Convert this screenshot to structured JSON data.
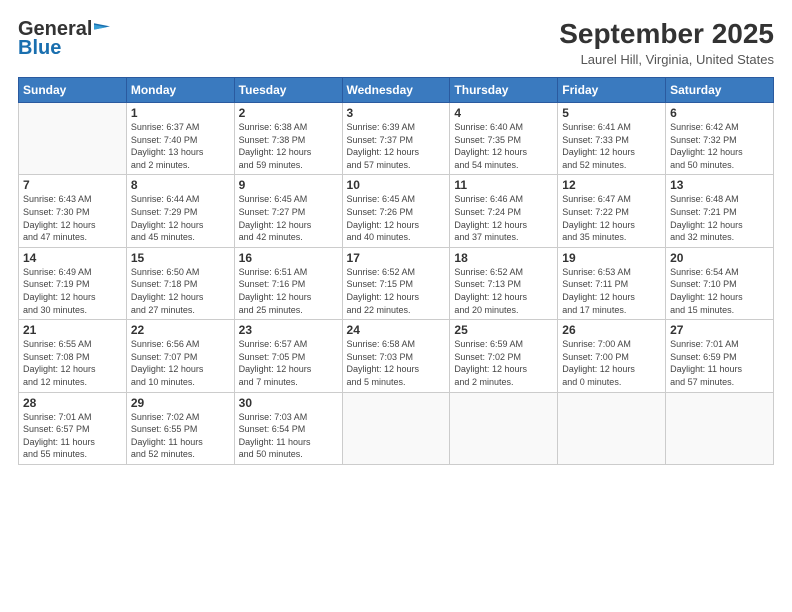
{
  "header": {
    "logo_general": "General",
    "logo_blue": "Blue",
    "month": "September 2025",
    "location": "Laurel Hill, Virginia, United States"
  },
  "weekdays": [
    "Sunday",
    "Monday",
    "Tuesday",
    "Wednesday",
    "Thursday",
    "Friday",
    "Saturday"
  ],
  "weeks": [
    [
      {
        "day": "",
        "info": ""
      },
      {
        "day": "1",
        "info": "Sunrise: 6:37 AM\nSunset: 7:40 PM\nDaylight: 13 hours\nand 2 minutes."
      },
      {
        "day": "2",
        "info": "Sunrise: 6:38 AM\nSunset: 7:38 PM\nDaylight: 12 hours\nand 59 minutes."
      },
      {
        "day": "3",
        "info": "Sunrise: 6:39 AM\nSunset: 7:37 PM\nDaylight: 12 hours\nand 57 minutes."
      },
      {
        "day": "4",
        "info": "Sunrise: 6:40 AM\nSunset: 7:35 PM\nDaylight: 12 hours\nand 54 minutes."
      },
      {
        "day": "5",
        "info": "Sunrise: 6:41 AM\nSunset: 7:33 PM\nDaylight: 12 hours\nand 52 minutes."
      },
      {
        "day": "6",
        "info": "Sunrise: 6:42 AM\nSunset: 7:32 PM\nDaylight: 12 hours\nand 50 minutes."
      }
    ],
    [
      {
        "day": "7",
        "info": "Sunrise: 6:43 AM\nSunset: 7:30 PM\nDaylight: 12 hours\nand 47 minutes."
      },
      {
        "day": "8",
        "info": "Sunrise: 6:44 AM\nSunset: 7:29 PM\nDaylight: 12 hours\nand 45 minutes."
      },
      {
        "day": "9",
        "info": "Sunrise: 6:45 AM\nSunset: 7:27 PM\nDaylight: 12 hours\nand 42 minutes."
      },
      {
        "day": "10",
        "info": "Sunrise: 6:45 AM\nSunset: 7:26 PM\nDaylight: 12 hours\nand 40 minutes."
      },
      {
        "day": "11",
        "info": "Sunrise: 6:46 AM\nSunset: 7:24 PM\nDaylight: 12 hours\nand 37 minutes."
      },
      {
        "day": "12",
        "info": "Sunrise: 6:47 AM\nSunset: 7:22 PM\nDaylight: 12 hours\nand 35 minutes."
      },
      {
        "day": "13",
        "info": "Sunrise: 6:48 AM\nSunset: 7:21 PM\nDaylight: 12 hours\nand 32 minutes."
      }
    ],
    [
      {
        "day": "14",
        "info": "Sunrise: 6:49 AM\nSunset: 7:19 PM\nDaylight: 12 hours\nand 30 minutes."
      },
      {
        "day": "15",
        "info": "Sunrise: 6:50 AM\nSunset: 7:18 PM\nDaylight: 12 hours\nand 27 minutes."
      },
      {
        "day": "16",
        "info": "Sunrise: 6:51 AM\nSunset: 7:16 PM\nDaylight: 12 hours\nand 25 minutes."
      },
      {
        "day": "17",
        "info": "Sunrise: 6:52 AM\nSunset: 7:15 PM\nDaylight: 12 hours\nand 22 minutes."
      },
      {
        "day": "18",
        "info": "Sunrise: 6:52 AM\nSunset: 7:13 PM\nDaylight: 12 hours\nand 20 minutes."
      },
      {
        "day": "19",
        "info": "Sunrise: 6:53 AM\nSunset: 7:11 PM\nDaylight: 12 hours\nand 17 minutes."
      },
      {
        "day": "20",
        "info": "Sunrise: 6:54 AM\nSunset: 7:10 PM\nDaylight: 12 hours\nand 15 minutes."
      }
    ],
    [
      {
        "day": "21",
        "info": "Sunrise: 6:55 AM\nSunset: 7:08 PM\nDaylight: 12 hours\nand 12 minutes."
      },
      {
        "day": "22",
        "info": "Sunrise: 6:56 AM\nSunset: 7:07 PM\nDaylight: 12 hours\nand 10 minutes."
      },
      {
        "day": "23",
        "info": "Sunrise: 6:57 AM\nSunset: 7:05 PM\nDaylight: 12 hours\nand 7 minutes."
      },
      {
        "day": "24",
        "info": "Sunrise: 6:58 AM\nSunset: 7:03 PM\nDaylight: 12 hours\nand 5 minutes."
      },
      {
        "day": "25",
        "info": "Sunrise: 6:59 AM\nSunset: 7:02 PM\nDaylight: 12 hours\nand 2 minutes."
      },
      {
        "day": "26",
        "info": "Sunrise: 7:00 AM\nSunset: 7:00 PM\nDaylight: 12 hours\nand 0 minutes."
      },
      {
        "day": "27",
        "info": "Sunrise: 7:01 AM\nSunset: 6:59 PM\nDaylight: 11 hours\nand 57 minutes."
      }
    ],
    [
      {
        "day": "28",
        "info": "Sunrise: 7:01 AM\nSunset: 6:57 PM\nDaylight: 11 hours\nand 55 minutes."
      },
      {
        "day": "29",
        "info": "Sunrise: 7:02 AM\nSunset: 6:55 PM\nDaylight: 11 hours\nand 52 minutes."
      },
      {
        "day": "30",
        "info": "Sunrise: 7:03 AM\nSunset: 6:54 PM\nDaylight: 11 hours\nand 50 minutes."
      },
      {
        "day": "",
        "info": ""
      },
      {
        "day": "",
        "info": ""
      },
      {
        "day": "",
        "info": ""
      },
      {
        "day": "",
        "info": ""
      }
    ]
  ]
}
